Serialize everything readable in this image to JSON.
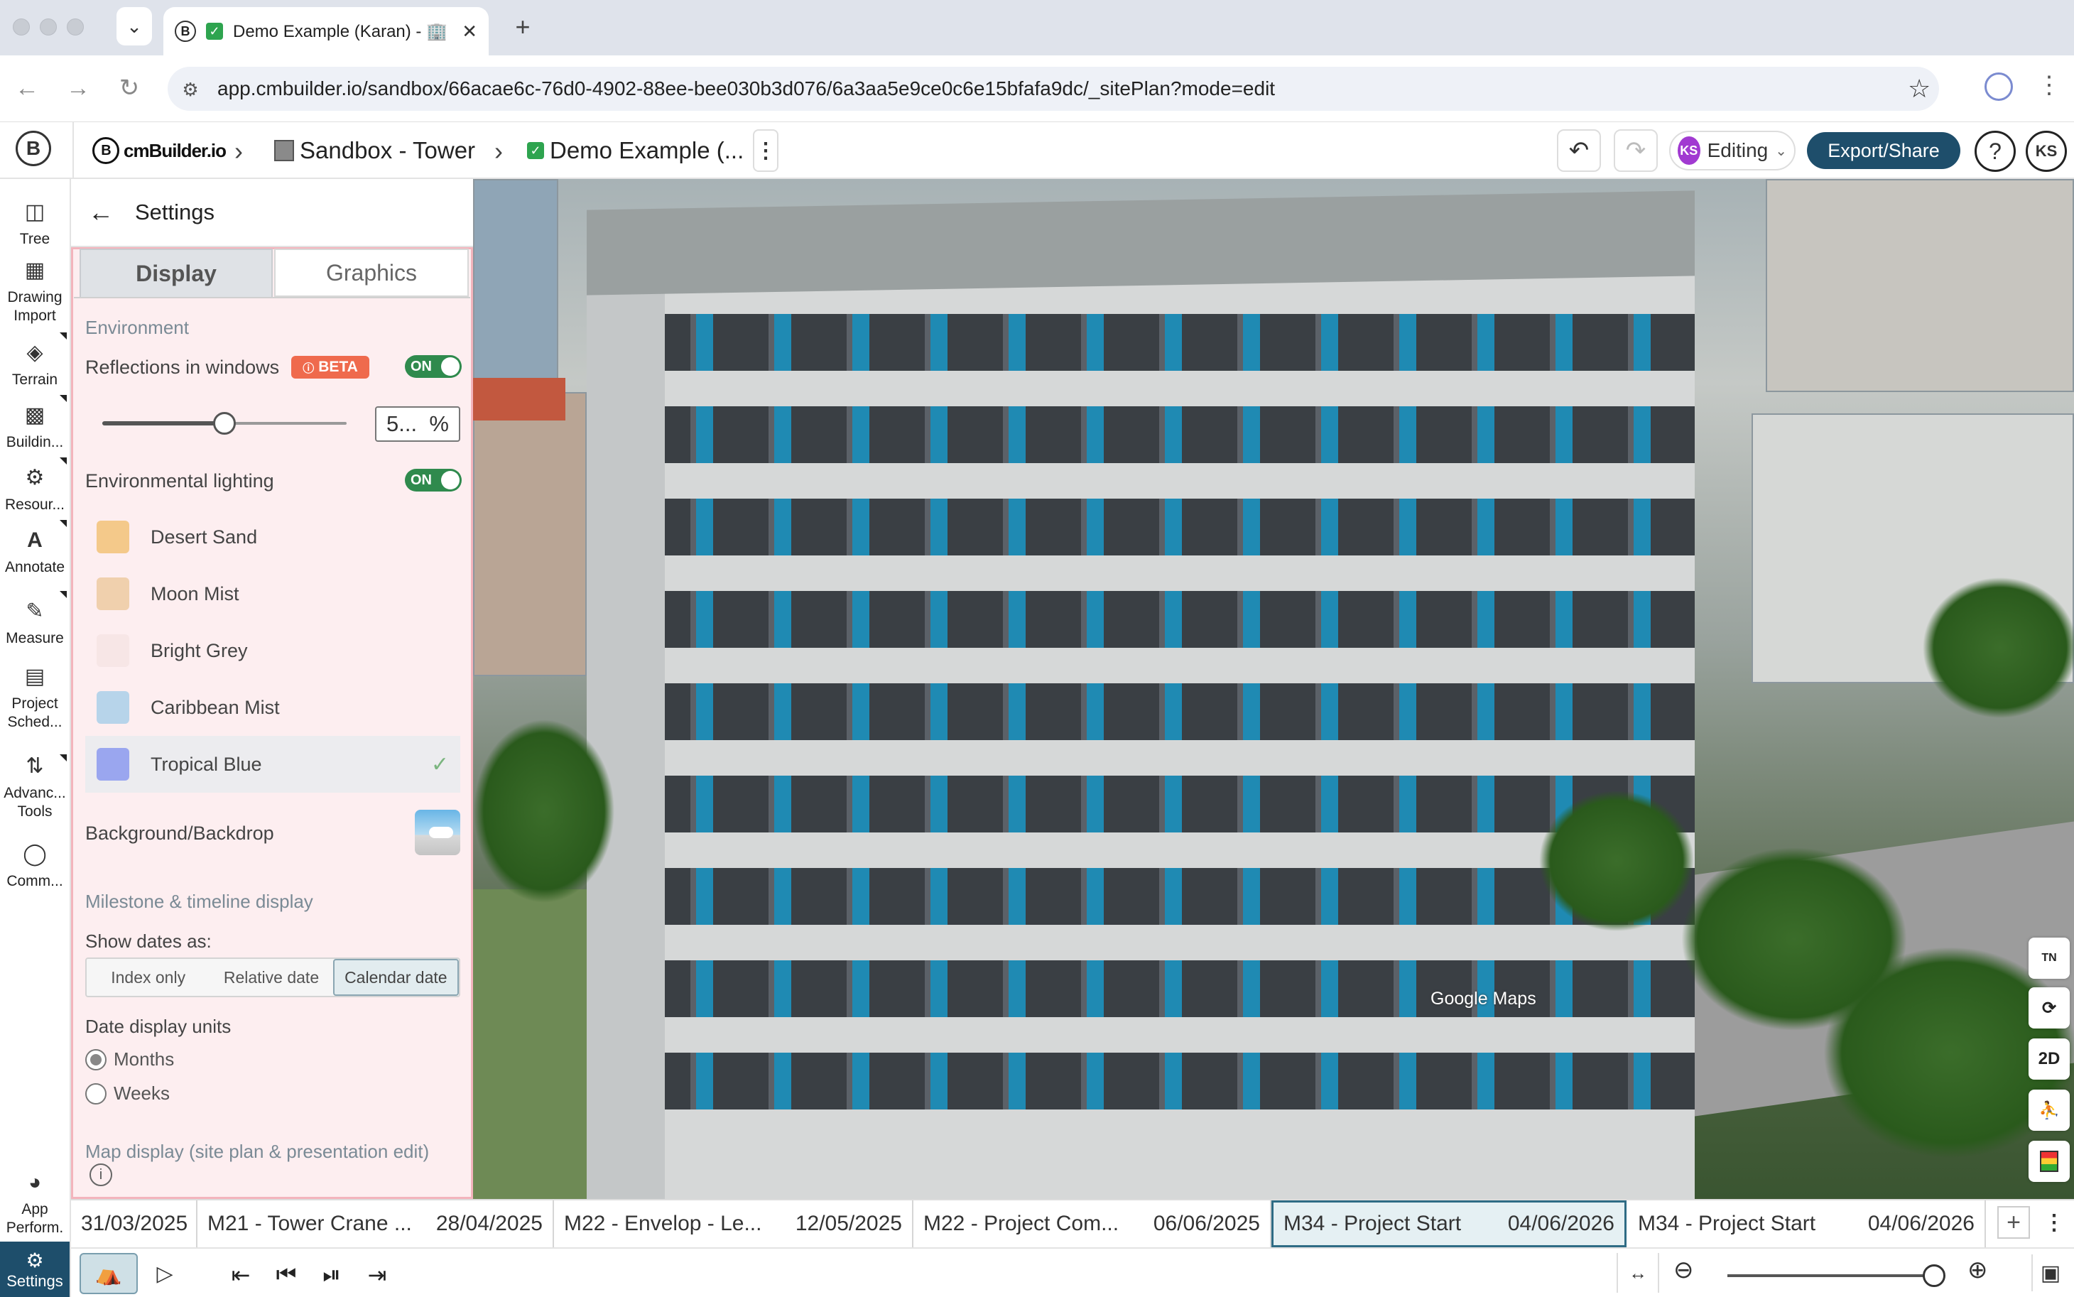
{
  "browser": {
    "tab_title": "Demo Example (Karan) - 🏢",
    "tab_close": "✕",
    "new_tab": "+",
    "url": "app.cmbuilder.io/sandbox/66acae6c-76d0-4902-88ee-bee030b3d076/6a3aa5e9ce0c6e15bfafa9dc/_sitePlan?mode=edit"
  },
  "header": {
    "brand": "cmBuilder.io",
    "crumb_sandbox": "Sandbox - Tower",
    "crumb_project": "Demo Example (...",
    "editing_label": "Editing",
    "editing_initials": "KS",
    "export_label": "Export/Share",
    "help_label": "?",
    "user_initials": "KS"
  },
  "sidebar": {
    "items": [
      {
        "label": "Tree",
        "icon": "tree-icon"
      },
      {
        "label": "Drawing Import",
        "icon": "image-icon"
      },
      {
        "label": "Terrain",
        "icon": "terrain-icon"
      },
      {
        "label": "Buildin...",
        "icon": "building-icon"
      },
      {
        "label": "Resour...",
        "icon": "resources-icon"
      },
      {
        "label": "Annotate",
        "icon": "annotate-icon"
      },
      {
        "label": "Measure",
        "icon": "measure-icon"
      },
      {
        "label": "Project Sched...",
        "icon": "schedule-icon"
      },
      {
        "label": "Advanc... Tools",
        "icon": "advanced-tools-icon"
      },
      {
        "label": "Comm...",
        "icon": "comment-icon"
      },
      {
        "label": "App Perform.",
        "icon": "performance-icon"
      }
    ],
    "settings_label": "Settings"
  },
  "settings": {
    "title": "Settings",
    "tabs": [
      "Display",
      "Graphics"
    ],
    "environment_title": "Environment",
    "reflections_label": "Reflections in windows",
    "beta_label": "BETA",
    "reflections_toggle": "ON",
    "reflection_value": "5...",
    "reflection_unit": "%",
    "reflection_fraction": 0.5,
    "env_lighting_label": "Environmental lighting",
    "env_lighting_toggle": "ON",
    "env_presets": [
      {
        "name": "Desert Sand",
        "color": "#f4c98a"
      },
      {
        "name": "Moon Mist",
        "color": "#f0d0ad"
      },
      {
        "name": "Bright Grey",
        "color": "#f7e6e6"
      },
      {
        "name": "Caribbean Mist",
        "color": "#b7d4ea"
      },
      {
        "name": "Tropical Blue",
        "color": "#9aa6ef",
        "selected": true
      }
    ],
    "background_label": "Background/Backdrop",
    "milestone_title": "Milestone & timeline display",
    "show_dates_label": "Show dates as:",
    "date_options": [
      "Index only",
      "Relative date",
      "Calendar date"
    ],
    "date_selected": "Calendar date",
    "units_label": "Date display units",
    "unit_months": "Months",
    "unit_weeks": "Weeks",
    "unit_selected": "Months",
    "map_display_title": "Map display (site plan & presentation edit)"
  },
  "viewport": {
    "google_label": "Google Maps",
    "tools": [
      "TN",
      "3D-rotate",
      "2D",
      "person",
      "layers"
    ]
  },
  "timeline": [
    {
      "title": "",
      "date": "31/03/2025"
    },
    {
      "title": "M21 - Tower Crane ...",
      "date": "28/04/2025"
    },
    {
      "title": "M22 - Envelop - Le...",
      "date": "12/05/2025"
    },
    {
      "title": "M22 - Project Com...",
      "date": "06/06/2025"
    },
    {
      "title": "M34 - Project Start",
      "date": "04/06/2026",
      "active": true
    },
    {
      "title": "M34 - Project Start",
      "date": "04/06/2026"
    }
  ],
  "playback": {
    "zoom_fraction": 0.95
  }
}
